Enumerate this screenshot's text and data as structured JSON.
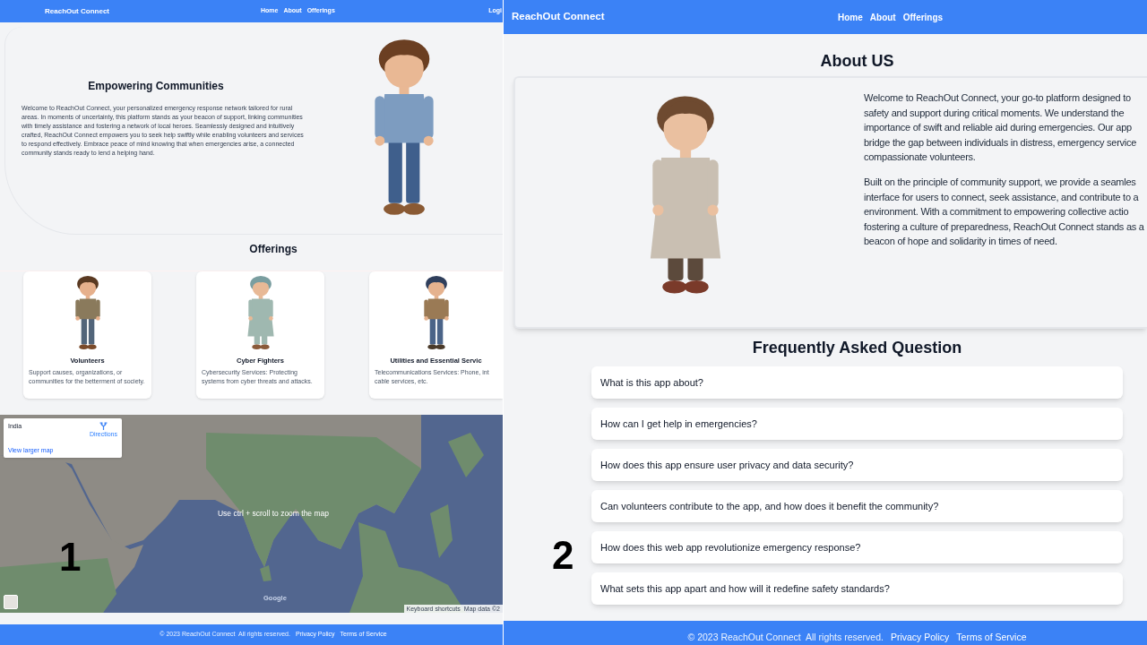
{
  "left_page": {
    "label": "1",
    "navbar": {
      "brand": "ReachOut Connect",
      "links": [
        {
          "label": "Home"
        },
        {
          "label": "About"
        },
        {
          "label": "Offerings"
        }
      ],
      "login": "Logi"
    },
    "hero": {
      "title": "Empowering Communities",
      "text": "Welcome to ReachOut Connect, your personalized emergency response network tailored for rural areas. In moments of uncertainty, this platform stands as your beacon of support, linking communities with timely assistance and fostering a network of local heroes. Seamlessly designed and intuitively crafted, ReachOut Connect empowers you to seek help swiftly while enabling volunteers and services to respond effectively. Embrace peace of mind knowing that when emergencies arise, a connected community stands ready to lend a helping hand."
    },
    "offerings": {
      "title": "Offerings",
      "cards": [
        {
          "title": "Volunteers",
          "text": "Support causes, organizations, or communities for the betterment of society."
        },
        {
          "title": "Cyber Fighters",
          "text": "Cybersecurity Services: Protecting systems from cyber threats and attacks."
        },
        {
          "title": "Utilities and Essential Servic",
          "text": "Telecommunications Services: Phone, int\ncable services, etc."
        }
      ]
    },
    "map": {
      "place": "India",
      "directions": "Directions",
      "larger_map_link": "View larger map",
      "hint": "Use ctrl + scroll to zoom the map",
      "logo": "Google",
      "shortcuts": "Keyboard shortcuts",
      "attribution": "Map data ©2"
    },
    "footer": {
      "copyright": "© 2023 ReachOut Connect  All rights reserved.",
      "links": [
        "Privacy Policy",
        "Terms of Service"
      ]
    }
  },
  "right_page": {
    "label": "2",
    "navbar": {
      "brand": "ReachOut Connect",
      "links": [
        {
          "label": "Home"
        },
        {
          "label": "About"
        },
        {
          "label": "Offerings"
        }
      ]
    },
    "about": {
      "title": "About US",
      "paragraphs": [
        "Welcome to ReachOut Connect, your go-to platform designed to\nsafety and support during critical moments. We understand the\nimportance of swift and reliable aid during emergencies. Our app\nbridge the gap between individuals in distress, emergency service\ncompassionate volunteers.",
        "Built on the principle of community support, we provide a seamles\ninterface for users to connect, seek assistance, and contribute to a\nenvironment. With a commitment to empowering collective actio\nfostering a culture of preparedness, ReachOut Connect stands as a\nbeacon of hope and solidarity in times of need."
      ]
    },
    "faq": {
      "title": "Frequently Asked Question",
      "questions": [
        "What is this app about?",
        "How can I get help in emergencies?",
        "How does this app ensure user privacy and data security?",
        "Can volunteers contribute to the app, and how does it benefit the community?",
        "How does this web app revolutionize emergency response?",
        "What sets this app apart and how will it redefine safety standards?"
      ]
    },
    "footer": {
      "copyright": "© 2023 ReachOut Connect  All rights reserved.",
      "links": [
        "Privacy Policy",
        "Terms of Service"
      ]
    }
  }
}
